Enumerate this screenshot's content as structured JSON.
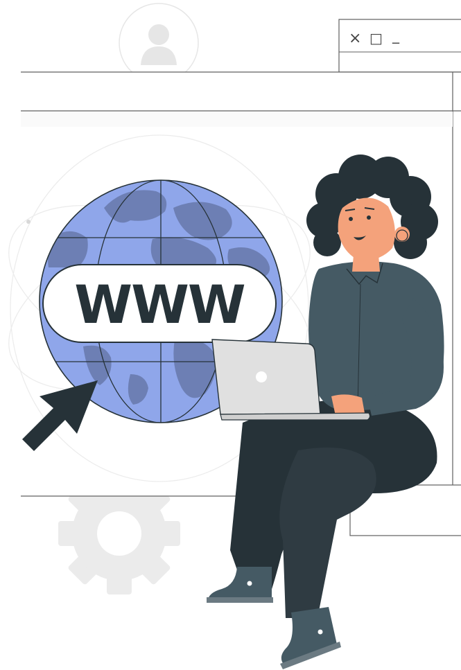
{
  "illustration": {
    "globe_label": "WWW",
    "window_controls": {
      "close_glyph": "×",
      "maximize_glyph": "□",
      "minimize_glyph": "_"
    },
    "colors": {
      "globe": "#8fa6ea",
      "continents": "#6d7fb4",
      "outline": "#263238",
      "shirt": "#455a64",
      "pants": "#263238",
      "skin": "#f4a27b",
      "hair": "#263238",
      "laptop": "#e0e0e0",
      "gear": "#ebebeb",
      "cursor": "#263238",
      "window_border": "#5f5f5f"
    },
    "icons": [
      "user-avatar-icon",
      "gear-icon",
      "cursor-arrow-icon",
      "globe-icon",
      "laptop-icon"
    ]
  }
}
